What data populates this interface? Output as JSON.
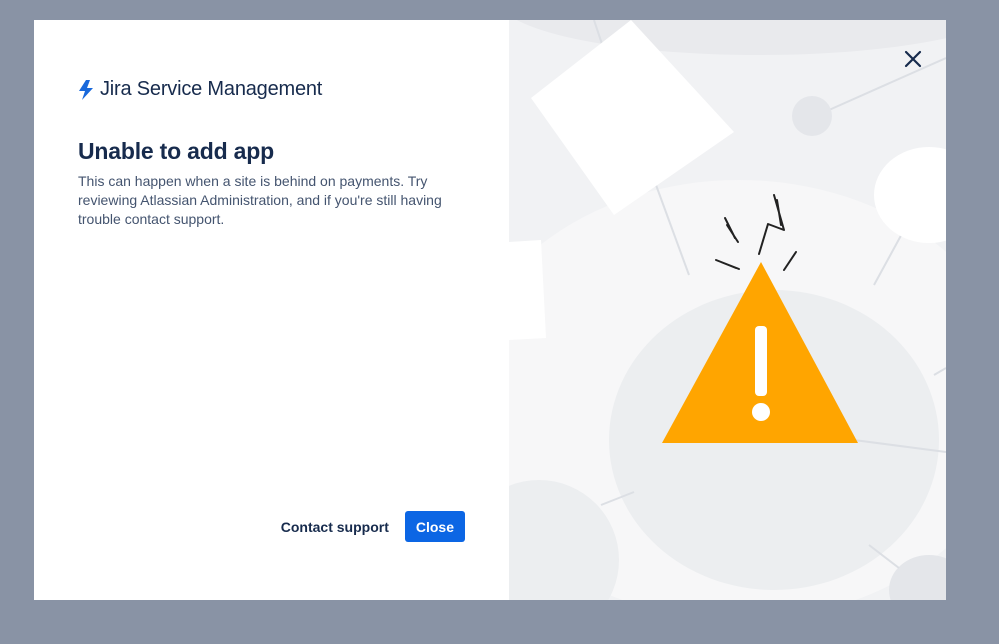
{
  "brand": {
    "name": "Jira Service Management",
    "logo_icon": "jira-bolt-icon",
    "logo_color": "#1868db"
  },
  "dialog": {
    "title": "Unable to add app",
    "description": "This can happen when a site is behind on payments. Try reviewing Atlassian Administration, and if you're still having trouble contact support.",
    "close_icon": "close-icon"
  },
  "actions": {
    "contact_support_label": "Contact support",
    "close_label": "Close"
  },
  "illustration": {
    "icon": "warning-triangle-icon",
    "warning_color": "#ffa500"
  },
  "colors": {
    "overlay": "#8993a5",
    "primary": "#0c66e4",
    "text": "#172b4d",
    "subtext": "#44546f"
  }
}
